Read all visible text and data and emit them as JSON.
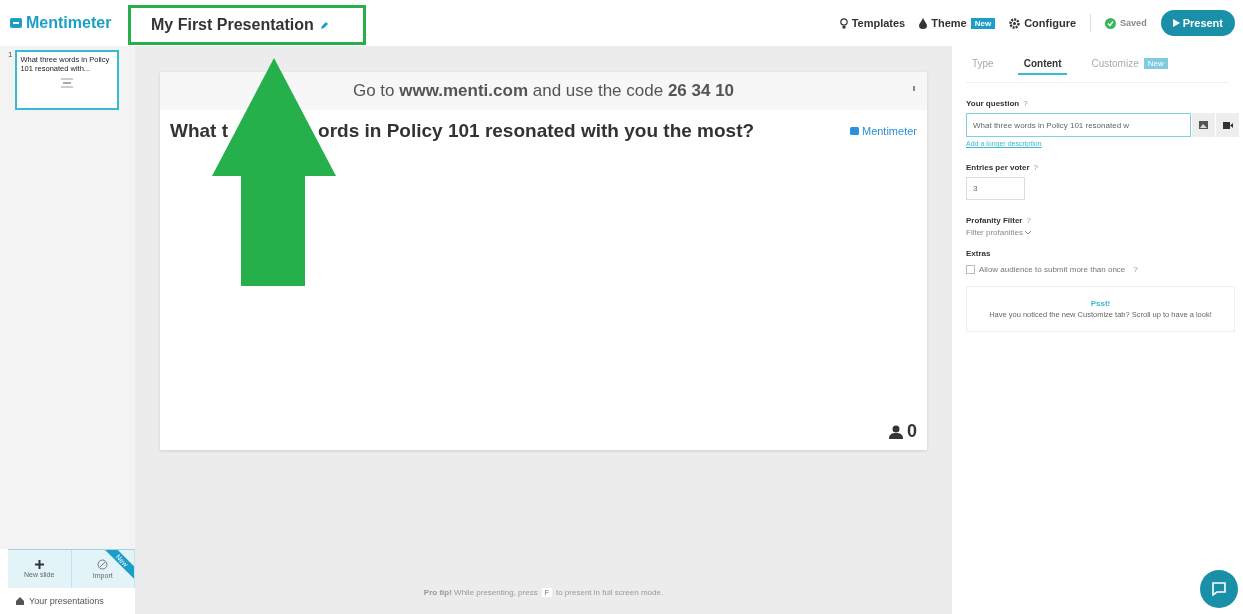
{
  "topbar": {
    "logo": "Mentimeter",
    "title": "My First Presentation",
    "highlighted": true,
    "actions": [
      {
        "label": "Templates"
      },
      {
        "label": "Theme",
        "badge": "New"
      },
      {
        "label": "Configure"
      }
    ],
    "status": "Saved",
    "present": "Present"
  },
  "sidebar": {
    "slides": [
      {
        "number": "1",
        "text": "What three words in Policy 101 resonated with...",
        "selected": true
      }
    ],
    "buttons": [
      {
        "label": "New slide"
      },
      {
        "label": "Import",
        "ribbon": "New"
      }
    ],
    "footer": "Your presentations"
  },
  "slide": {
    "instruction": "Go to **www.menti.com** and use the code **26 34 10**",
    "title_start": "What t",
    "title_end": "ords in Policy 101 resonated with you the most?",
    "brand": "Mentimeter",
    "count": "0"
  },
  "annotation": {
    "arrow": true
  },
  "pro_tip": {
    "before": "**Pro tip!** While presenting, press",
    "key": "F",
    "after": "to present in full screen mode."
  },
  "panel": {
    "tabs": [
      {
        "label": "Type",
        "selected": false
      },
      {
        "label": "Content",
        "selected": true
      },
      {
        "label": "Customize",
        "selected": false,
        "badge": "New"
      }
    ],
    "help": "?",
    "question_label": "Your question",
    "question_value": "What three words in Policy 101 resonated w",
    "description_link": "Add a longer description",
    "entries_label": "Entries per voter",
    "entries_value": "3",
    "profanity_label": "Profanity Filter",
    "profanity_value": "Filter profanities",
    "extras_label": "Extras",
    "extras": [
      {
        "label": "Allow audience to submit more than once",
        "checked": false
      }
    ],
    "notice_title": "Psst!",
    "notice_text": "Have you noticed the new Customize tab? Scroll up to have a look!"
  }
}
